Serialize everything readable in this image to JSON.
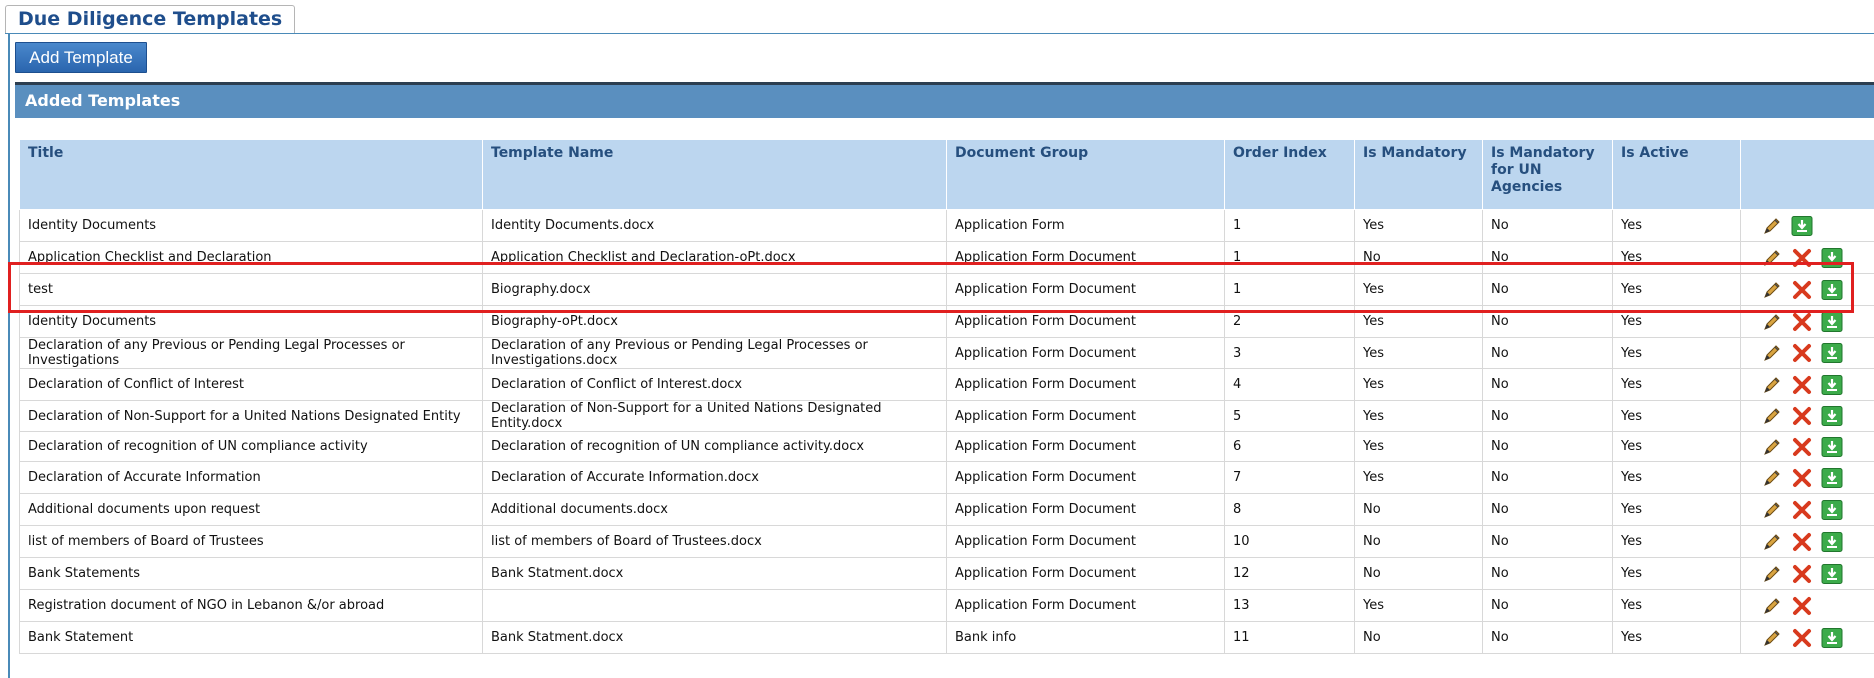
{
  "tab": {
    "label": "Due Diligence Templates"
  },
  "toolbar": {
    "add_label": "Add Template"
  },
  "section": {
    "title": "Added Templates"
  },
  "columns": [
    "Title",
    "Template Name",
    "Document Group",
    "Order Index",
    "Is Mandatory",
    "Is Mandatory for UN Agencies",
    "Is Active"
  ],
  "rows": [
    {
      "title": "Identity Documents",
      "template": "Identity Documents.docx",
      "group": "Application Form",
      "order": "1",
      "mandatory": "Yes",
      "mandatory_un": "No",
      "active": "Yes",
      "actions": [
        "edit",
        "download"
      ]
    },
    {
      "title": "Application Checklist and Declaration",
      "template": "Application Checklist and Declaration-oPt.docx",
      "group": "Application Form Document",
      "order": "1",
      "mandatory": "No",
      "mandatory_un": "No",
      "active": "Yes",
      "actions": [
        "edit",
        "delete",
        "download"
      ]
    },
    {
      "title": "test",
      "template": "Biography.docx",
      "group": "Application Form Document",
      "order": "1",
      "mandatory": "Yes",
      "mandatory_un": "No",
      "active": "Yes",
      "actions": [
        "edit",
        "delete",
        "download"
      ]
    },
    {
      "title": "Identity Documents",
      "template": "Biography-oPt.docx",
      "group": "Application Form Document",
      "order": "2",
      "mandatory": "Yes",
      "mandatory_un": "No",
      "active": "Yes",
      "actions": [
        "edit",
        "delete",
        "download"
      ]
    },
    {
      "title": "Declaration of any Previous or Pending Legal Processes or Investigations",
      "template": "Declaration of any Previous or Pending Legal Processes or Investigations.docx",
      "group": "Application Form Document",
      "order": "3",
      "mandatory": "Yes",
      "mandatory_un": "No",
      "active": "Yes",
      "actions": [
        "edit",
        "delete",
        "download"
      ]
    },
    {
      "title": "Declaration of Conflict of Interest",
      "template": "Declaration of Conflict of Interest.docx",
      "group": "Application Form Document",
      "order": "4",
      "mandatory": "Yes",
      "mandatory_un": "No",
      "active": "Yes",
      "actions": [
        "edit",
        "delete",
        "download"
      ]
    },
    {
      "title": "Declaration of Non-Support for a United Nations Designated Entity",
      "template": "Declaration of Non-Support for a United Nations Designated Entity.docx",
      "group": "Application Form Document",
      "order": "5",
      "mandatory": "Yes",
      "mandatory_un": "No",
      "active": "Yes",
      "actions": [
        "edit",
        "delete",
        "download"
      ]
    },
    {
      "title": "Declaration of recognition of UN compliance activity",
      "template": "Declaration of recognition of UN compliance activity.docx",
      "group": "Application Form Document",
      "order": "6",
      "mandatory": "Yes",
      "mandatory_un": "No",
      "active": "Yes",
      "actions": [
        "edit",
        "delete",
        "download"
      ]
    },
    {
      "title": "Declaration of Accurate Information",
      "template": "Declaration of Accurate Information.docx",
      "group": "Application Form Document",
      "order": "7",
      "mandatory": "Yes",
      "mandatory_un": "No",
      "active": "Yes",
      "actions": [
        "edit",
        "delete",
        "download"
      ]
    },
    {
      "title": "Additional documents upon request",
      "template": "Additional documents.docx",
      "group": "Application Form Document",
      "order": "8",
      "mandatory": "No",
      "mandatory_un": "No",
      "active": "Yes",
      "actions": [
        "edit",
        "delete",
        "download"
      ]
    },
    {
      "title": "list of members of Board of Trustees",
      "template": "list of members of Board of Trustees.docx",
      "group": "Application Form Document",
      "order": "10",
      "mandatory": "No",
      "mandatory_un": "No",
      "active": "Yes",
      "actions": [
        "edit",
        "delete",
        "download"
      ]
    },
    {
      "title": "Bank Statements",
      "template": "Bank Statment.docx",
      "group": "Application Form Document",
      "order": "12",
      "mandatory": "No",
      "mandatory_un": "No",
      "active": "Yes",
      "actions": [
        "edit",
        "delete",
        "download"
      ]
    },
    {
      "title": "Registration document of NGO in Lebanon &/or abroad",
      "template": "",
      "group": "Application Form Document",
      "order": "13",
      "mandatory": "Yes",
      "mandatory_un": "No",
      "active": "Yes",
      "actions": [
        "edit",
        "delete"
      ]
    },
    {
      "title": "Bank Statement",
      "template": "Bank Statment.docx",
      "group": "Bank info",
      "order": "11",
      "mandatory": "No",
      "mandatory_un": "No",
      "active": "Yes",
      "actions": [
        "edit",
        "delete",
        "download"
      ]
    }
  ],
  "highlight": {
    "row_index": 2,
    "color": "#e02020"
  }
}
